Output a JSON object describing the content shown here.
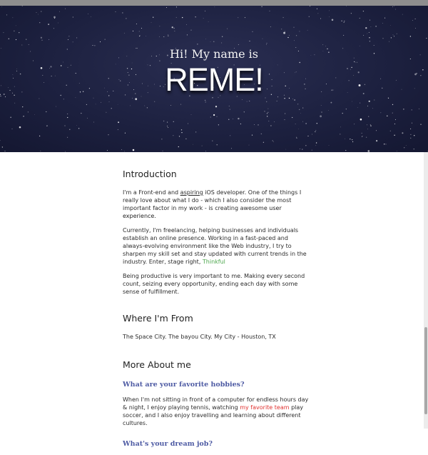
{
  "hero": {
    "greeting": "Hi! My name is",
    "name": "REME!"
  },
  "intro": {
    "title": "Introduction",
    "p1_a": "I'm a Front-end and ",
    "p1_aspiring": "aspiring",
    "p1_b": " iOS developer. One of the things I really love about what I do - which I also consider the most important factor in my work - is creating awesome ",
    "p1_user_experience": "user experience",
    "p1_c": ".",
    "p2_a": "Currently, I'm freelancing, helping businesses and individuals establish an online presence. Working in a fast-paced and always-evolving environment like the Web industry, I try to sharpen my skill set and stay updated with current trends in the industry. Enter, stage right, ",
    "p2_thinkful": "Thinkful",
    "p3": "Being productive is very important to me. Making every second count, seizing every opportunity, ending each day with some sense of fulfillment."
  },
  "from": {
    "title": "Where I'm From",
    "text": "The Space City. The bayou City. My City - Houston, TX"
  },
  "more": {
    "title": "More About me",
    "q1": "What are your favorite hobbies?",
    "a1_a": "When I'm not sitting in front of a computer for endless hours day & night, I enjoy playing tennis, watching ",
    "a1_team": "my favorite team",
    "a1_b": " play soccer, and I also enjoy travelling and learning about different cultures.",
    "q2": "What's your dream job?"
  },
  "colors": {
    "hero_bg": "#1d2140",
    "link_green": "#4ca64c",
    "link_red": "#e0312f",
    "question": "#4d5aa3"
  }
}
